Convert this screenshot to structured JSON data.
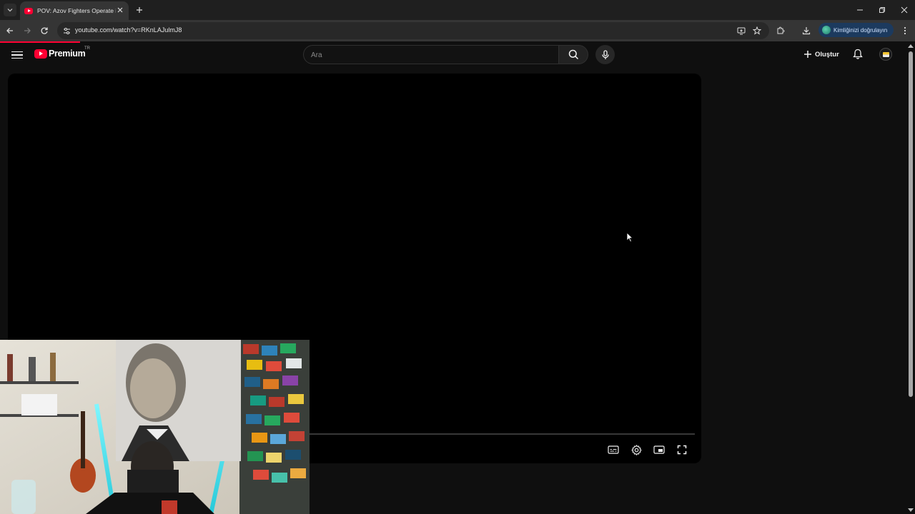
{
  "browser": {
    "tab": {
      "title": "POV: Azov Fighters Operate in"
    },
    "url": "youtube.com/watch?v=RKnLAJulmJ8",
    "identity_label": "Kimliğinizi doğrulayın"
  },
  "youtube": {
    "logo_text": "Premium",
    "country_code": "TR",
    "search_placeholder": "Ara",
    "create_label": "Oluştur"
  },
  "player": {
    "progress": 0,
    "controls": [
      "subtitles-icon",
      "settings-icon",
      "miniplayer-icon",
      "fullscreen-icon"
    ]
  },
  "colors": {
    "accent": "#ff0033",
    "background": "#0f0f0f",
    "player": "#000000",
    "identity_chip": "#1c3a5e"
  }
}
